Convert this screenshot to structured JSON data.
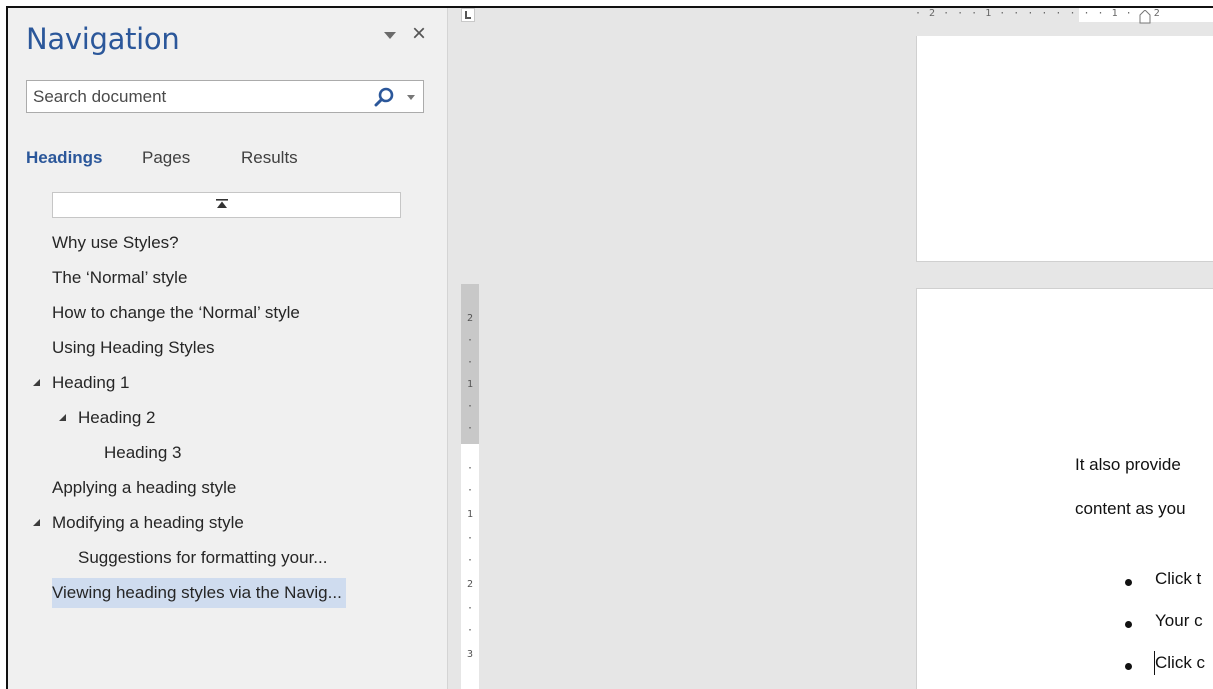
{
  "navigation": {
    "title": "Navigation",
    "search": {
      "placeholder": "Search document",
      "value": ""
    },
    "tabs": [
      {
        "label": "Headings",
        "active": true
      },
      {
        "label": "Pages",
        "active": false
      },
      {
        "label": "Results",
        "active": false
      }
    ],
    "headings": [
      {
        "label": "Why use Styles?",
        "level": 1,
        "expanded": null,
        "selected": false
      },
      {
        "label": "The ‘Normal’ style",
        "level": 1,
        "expanded": null,
        "selected": false
      },
      {
        "label": "How to change the ‘Normal’ style",
        "level": 1,
        "expanded": null,
        "selected": false
      },
      {
        "label": "Using Heading Styles",
        "level": 1,
        "expanded": null,
        "selected": false
      },
      {
        "label": "Heading 1",
        "level": 1,
        "expanded": true,
        "selected": false
      },
      {
        "label": "Heading 2",
        "level": 2,
        "expanded": true,
        "selected": false
      },
      {
        "label": "Heading 3",
        "level": 3,
        "expanded": null,
        "selected": false
      },
      {
        "label": "Applying a heading style",
        "level": 1,
        "expanded": null,
        "selected": false
      },
      {
        "label": "Modifying a heading style",
        "level": 1,
        "expanded": true,
        "selected": false
      },
      {
        "label": "Suggestions for formatting your...",
        "level": 2,
        "expanded": null,
        "selected": false
      },
      {
        "label": "Viewing heading styles via the Navig...",
        "level": 1,
        "expanded": null,
        "selected": true
      }
    ]
  },
  "document": {
    "h_ruler_text": "· 2 · · · 1 · · · · · · · · 1 · · 2",
    "v_ruler_marks": [
      "2",
      "·",
      "·",
      "1",
      "·",
      "·",
      "·",
      "·",
      "1",
      "·",
      "·",
      "2",
      "·",
      "·",
      "3"
    ],
    "lines": [
      "It also provide",
      "content as you"
    ],
    "bullets": [
      "Click t",
      "Your c",
      "Click c"
    ]
  },
  "colors": {
    "accent": "#2b579a",
    "selection": "#cfdcef",
    "pane_bg": "#f0f0f0",
    "canvas_bg": "#e6e6e6"
  }
}
